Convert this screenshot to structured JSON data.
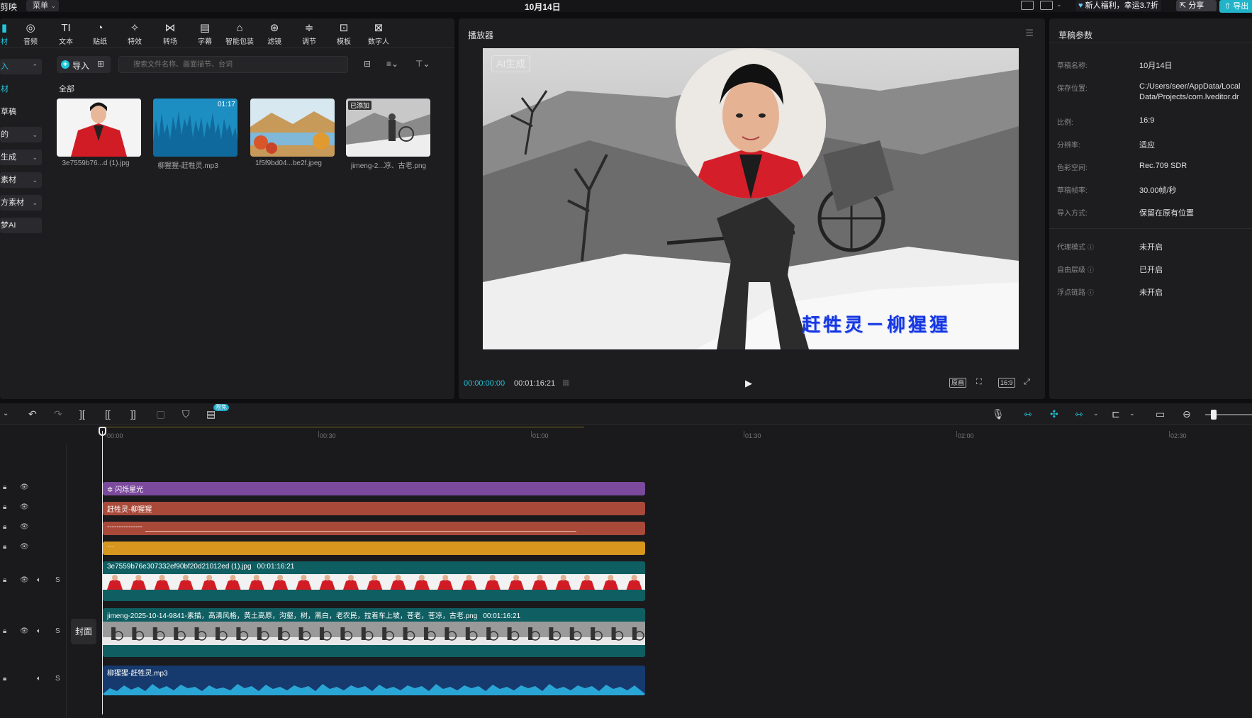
{
  "titlebar": {
    "app_name": "剪映",
    "menu_label": "菜单",
    "project_title": "10月14日",
    "promo": "新人福利，幸运3.7折",
    "share": "分享",
    "export": "导出"
  },
  "toolbar": {
    "items": [
      {
        "label": "材",
        "icon": "media-icon"
      },
      {
        "label": "音频",
        "icon": "audio-icon"
      },
      {
        "label": "文本",
        "icon": "text-icon"
      },
      {
        "label": "贴纸",
        "icon": "sticker-icon"
      },
      {
        "label": "特效",
        "icon": "effects-icon"
      },
      {
        "label": "转场",
        "icon": "transition-icon"
      },
      {
        "label": "字幕",
        "icon": "subtitle-icon"
      },
      {
        "label": "智能包装",
        "icon": "smart-pack-icon"
      },
      {
        "label": "滤镜",
        "icon": "filter-icon"
      },
      {
        "label": "调节",
        "icon": "adjust-icon"
      },
      {
        "label": "模板",
        "icon": "template-icon"
      },
      {
        "label": "数字人",
        "icon": "digital-human-icon"
      }
    ]
  },
  "sidebar": {
    "items": [
      {
        "label": "入"
      },
      {
        "label": "材"
      },
      {
        "label": "草稿"
      },
      {
        "label": "的"
      },
      {
        "label": "生成"
      },
      {
        "label": "素材"
      },
      {
        "label": "方素材"
      },
      {
        "label": "梦AI"
      }
    ]
  },
  "media": {
    "import_label": "导入",
    "search_placeholder": "搜索文件名称、画面描节、台词",
    "all_label": "全部",
    "items": [
      {
        "name": "3e7559b76...d (1).jpg",
        "badge": "",
        "duration": ""
      },
      {
        "name": "柳猩猩-赶牲灵.mp3",
        "badge": "",
        "duration": "01:17"
      },
      {
        "name": "1f5f9bd04...be2f.jpeg",
        "badge": "",
        "duration": ""
      },
      {
        "name": "jimeng-2...凉、古老.png",
        "badge": "已添加",
        "duration": ""
      }
    ]
  },
  "player": {
    "title": "播放器",
    "ai_badge": "AI生成",
    "overlay_text": "赶牲灵－柳猩猩",
    "current_time": "00:00:00:00",
    "total_time": "00:01:16:21",
    "ratio": "16:9",
    "original_label": "原画"
  },
  "props": {
    "title": "草稿参数",
    "rows": [
      {
        "k": "草稿名称:",
        "v": "10月14日"
      },
      {
        "k": "保存位置:",
        "v": "C:/Users/seer/AppData/Local",
        "v2": "Data/Projects/com.lveditor.dr"
      },
      {
        "k": "比例:",
        "v": "16:9"
      },
      {
        "k": "分辨率:",
        "v": "适应"
      },
      {
        "k": "色彩空间:",
        "v": "Rec.709 SDR"
      },
      {
        "k": "草稿帧率:",
        "v": "30.00帧/秒"
      },
      {
        "k": "导入方式:",
        "v": "保留在原有位置"
      },
      {
        "k": "代理模式",
        "v": "未开启"
      },
      {
        "k": "自由层级",
        "v": "已开启"
      },
      {
        "k": "浮点链路",
        "v": "未开启"
      }
    ]
  },
  "timeline": {
    "free_badge": "限免",
    "ticks": [
      "00:00",
      "00:30",
      "01:00",
      "01:30",
      "02:00",
      "02:30"
    ],
    "cover_label": "封面",
    "tracks": [
      {
        "label": "闪烁星光",
        "color": "#7b4a9c"
      },
      {
        "label": "赶牲灵-柳猩猩",
        "color": "#a8493a"
      },
      {
        "label": "---------------",
        "color": "#a8493a"
      },
      {
        "label": "···",
        "color": "#d7961e"
      },
      {
        "label": "3e7559b76e307332ef90bf20d21012ed (1).jpg",
        "duration": "00:01:16:21",
        "color": "#0f5e62"
      },
      {
        "label": "jimeng-2025-10-14-9841-素描，高清风格，黄土高原，沟壑，树，黑白，老农民，拉着车上坡，苍老，苍凉，古老.png",
        "duration": "00:01:16:21",
        "color": "#0f5e62"
      },
      {
        "label": "柳猩猩-赶牲灵.mp3",
        "color": "#163a6e"
      }
    ]
  },
  "colors": {
    "accent": "#21c7dc",
    "panel": "#1d1d20"
  }
}
